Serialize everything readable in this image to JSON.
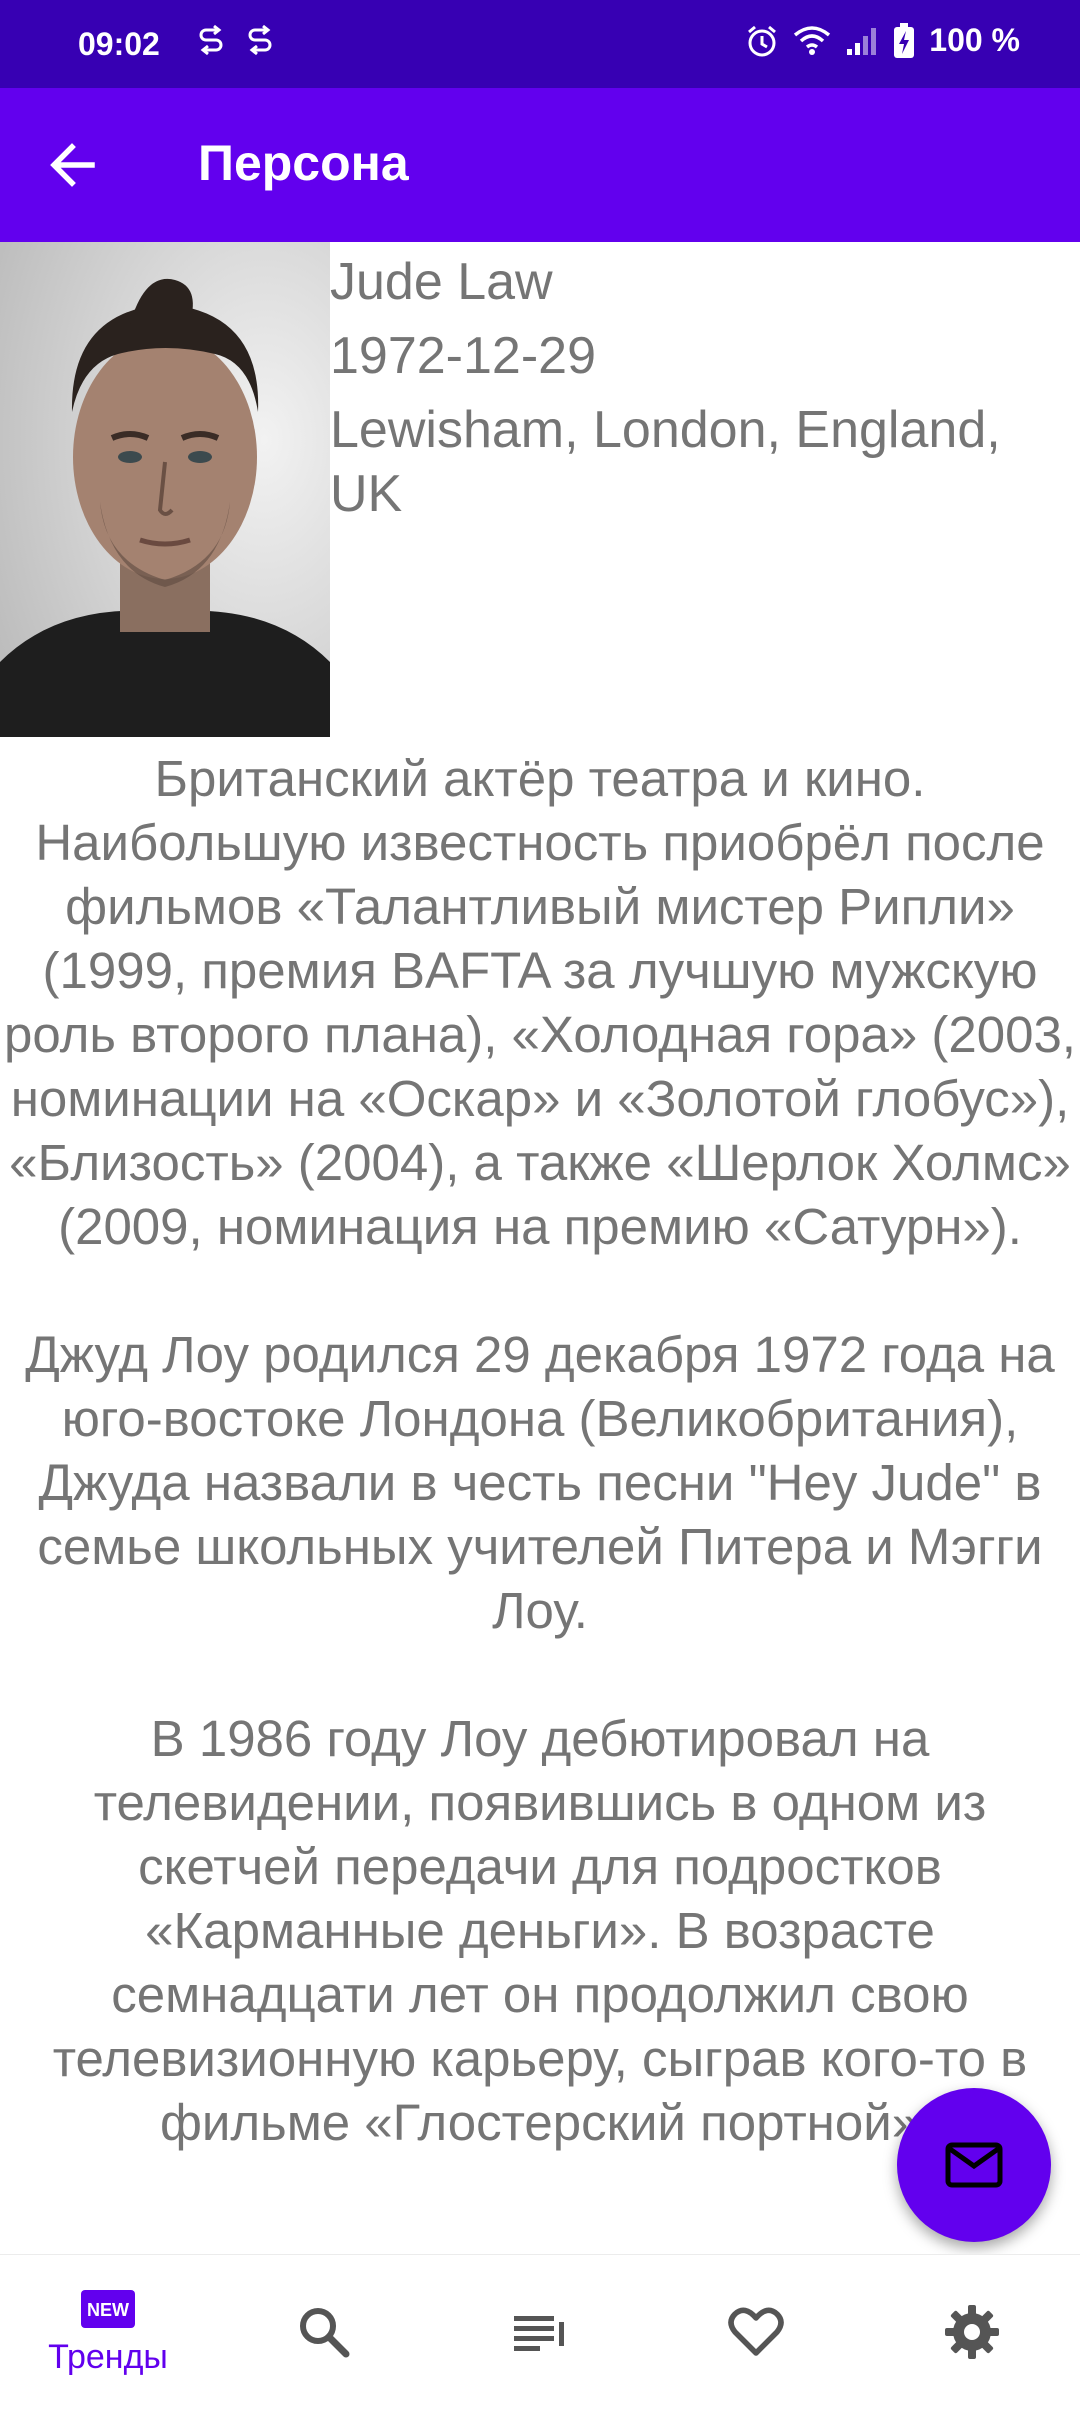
{
  "status_bar": {
    "time": "09:02",
    "battery": "100 %",
    "icons": [
      "sync-icon",
      "sync-icon",
      "alarm-icon",
      "wifi-icon",
      "signal-icon",
      "battery-charging-icon"
    ]
  },
  "app_bar": {
    "title": "Персона",
    "back_icon": "arrow-back-icon"
  },
  "person": {
    "name": "Jude Law",
    "birthday": "1972-12-29",
    "place_of_birth": "Lewisham, London, England, UK"
  },
  "biography": {
    "paragraphs": [
      "Британский актёр театра и кино. Наибольшую известность приобрёл после фильмов «Талантливый мистер Рипли» (1999, премия BAFTA за лучшую мужскую роль второго плана), «Холодная гора» (2003, номинации на «Оскар» и «Золотой глобус»), «Близость» (2004), а также «Шерлок Холмс» (2009, номинация на премию «Сатурн»).",
      "Джуд Лоу родился 29 декабря 1972 года на юго-востоке Лондона (Великобритания), Джуда назвали в честь песни \"Hey Jude\" в семье школьных учителей Питера и Мэгги Лоу.",
      "В 1986 году Лоу дебютировал на телевидении, появившись в одном из скетчей передачи для подростков «Карманные деньги». В возрасте семнадцати лет он продолжил свою телевизионную карьеру, сыграв кого-то в фильме «Глостерский портной»"
    ]
  },
  "bottom_nav": {
    "items": [
      {
        "label": "Тренды",
        "icon": "new-badge-icon",
        "active": true
      },
      {
        "icon": "search-icon"
      },
      {
        "icon": "list-icon"
      },
      {
        "icon": "heart-icon"
      },
      {
        "icon": "gear-icon"
      }
    ],
    "accent": "#6200ee",
    "inactive": "#555555"
  },
  "fab": {
    "icon": "mail-icon"
  },
  "colors": {
    "status_bar": "#3700b3",
    "app_bar": "#6200ee",
    "text": "#757575"
  }
}
